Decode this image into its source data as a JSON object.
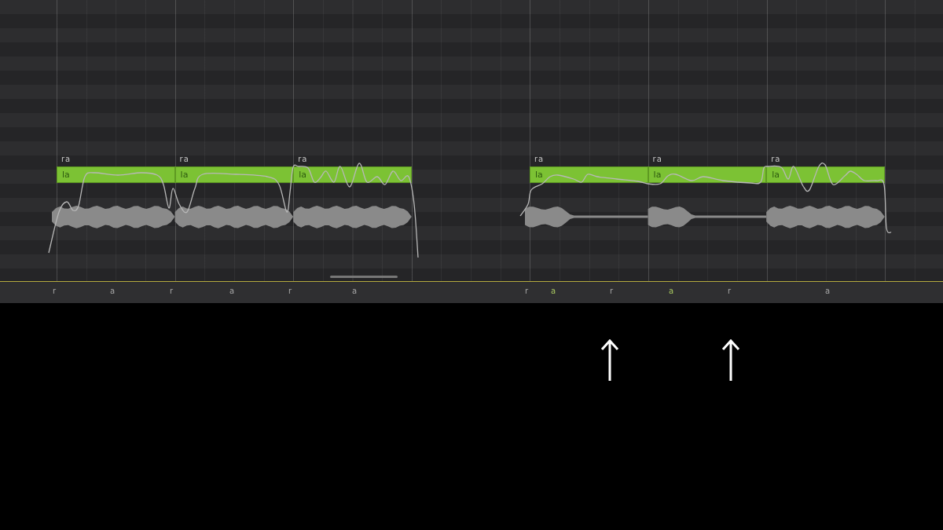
{
  "phrases": [
    {
      "notes": [
        {
          "phonemes": "ra",
          "lyric": "la"
        },
        {
          "phonemes": "ra",
          "lyric": "la"
        },
        {
          "phonemes": "ra",
          "lyric": "la"
        }
      ],
      "phoneme_track": [
        {
          "text": "r",
          "highlighted": false
        },
        {
          "text": "a",
          "highlighted": false
        },
        {
          "text": "r",
          "highlighted": false
        },
        {
          "text": "a",
          "highlighted": false
        },
        {
          "text": "r",
          "highlighted": false
        },
        {
          "text": "a",
          "highlighted": false
        }
      ]
    },
    {
      "notes": [
        {
          "phonemes": "ra",
          "lyric": "la"
        },
        {
          "phonemes": "ra",
          "lyric": "la"
        },
        {
          "phonemes": "ra",
          "lyric": "la"
        }
      ],
      "phoneme_track": [
        {
          "text": "r",
          "highlighted": false
        },
        {
          "text": "a",
          "highlighted": true
        },
        {
          "text": "r",
          "highlighted": false
        },
        {
          "text": "a",
          "highlighted": true
        },
        {
          "text": "r",
          "highlighted": false
        },
        {
          "text": "a",
          "highlighted": false
        }
      ]
    }
  ]
}
